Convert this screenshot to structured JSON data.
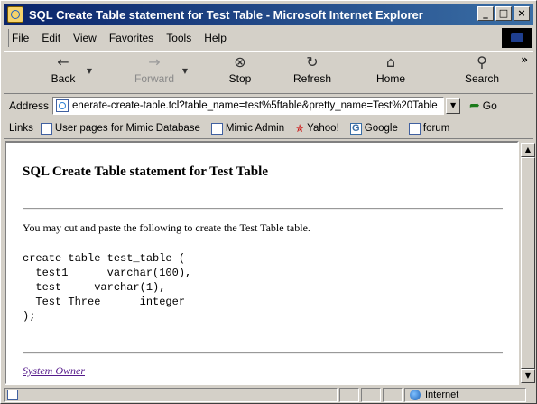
{
  "window": {
    "title": "SQL Create Table statement for Test Table - Microsoft Internet Explorer",
    "controls": {
      "minimize": "_",
      "maximize": "□",
      "close": "×"
    }
  },
  "menu": [
    "File",
    "Edit",
    "View",
    "Favorites",
    "Tools",
    "Help"
  ],
  "toolbar": {
    "back": "Back",
    "forward": "Forward",
    "stop": "Stop",
    "refresh": "Refresh",
    "home": "Home",
    "search": "Search",
    "more": "»",
    "icons": {
      "back": "back-arrow-icon",
      "forward": "forward-arrow-icon",
      "stop": "stop-icon",
      "refresh": "refresh-icon",
      "home": "home-icon",
      "search": "search-icon"
    }
  },
  "address": {
    "label": "Address",
    "value": "enerate-create-table.tcl?table_name=test%5ftable&pretty_name=Test%20Table",
    "go": "Go"
  },
  "links": {
    "label": "Links",
    "items": [
      "User pages for Mimic Database",
      "Mimic Admin",
      "Yahoo!",
      "Google",
      "forum"
    ]
  },
  "page": {
    "heading": "SQL Create Table statement for Test Table",
    "intro": "You may cut and paste the following to create the Test Table table.",
    "code": "create table test_table (\n  test1      varchar(100),\n  test     varchar(1),\n  Test Three      integer\n);",
    "owner_link": "System Owner"
  },
  "status": {
    "zone": "Internet"
  }
}
